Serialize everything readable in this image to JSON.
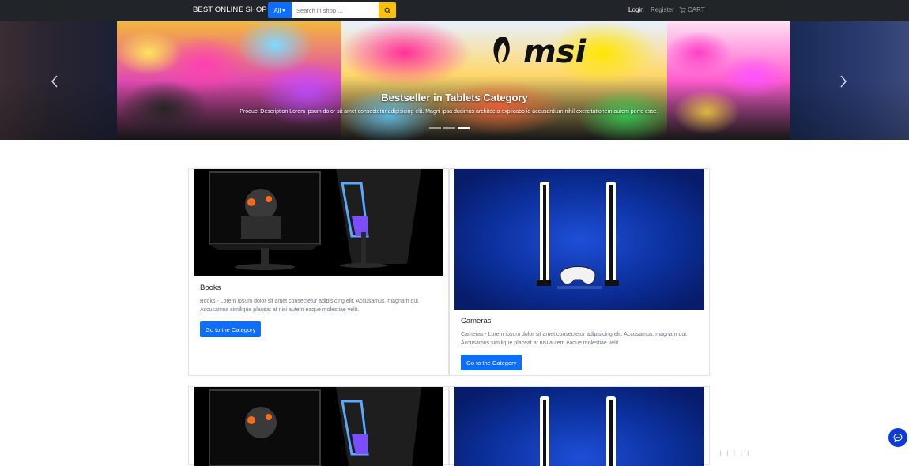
{
  "navbar": {
    "brand": "BEST ONLINE SHOP",
    "category_button": "All",
    "search_placeholder": "Search in shop ...",
    "login": "Login",
    "register": "Register",
    "cart": "CART"
  },
  "hero": {
    "title": "Bestseller in Tablets Category",
    "description": "Product Description Lorem ipsum dolor sit amet consectetur adipisicing elit. Magni ipsa ducimus architecto explicabo id accusantium nihil exercitationem autem porro esse.",
    "slides": 3,
    "active_slide": 3
  },
  "cards": [
    {
      "title": "Books",
      "text": "Books - Lorem ipsum dolor sit amet consectetur adipisicing elit. Accusamus, magnam qui. Accusamus similique placeat at nisi autem eaque molestiae velit.",
      "button": "Go to the Category",
      "image": "gaming-monitor"
    },
    {
      "title": "Cameras",
      "text": "Cameras - Lorem ipsum dolor sit amet consectetur adipisicing elit. Accusamus, magnam qui. Accusamus similique placeat at nisi autem eaque molestiae velit.",
      "button": "Go to the Category",
      "image": "game-console"
    }
  ],
  "colors": {
    "navbar": "#212529",
    "primary": "#0d6efd",
    "search_button": "#ffc107",
    "chat": "#0d3bd9"
  },
  "icons": [
    "search-icon",
    "cart-icon",
    "chevron-left-icon",
    "chevron-right-icon",
    "chat-icon"
  ]
}
